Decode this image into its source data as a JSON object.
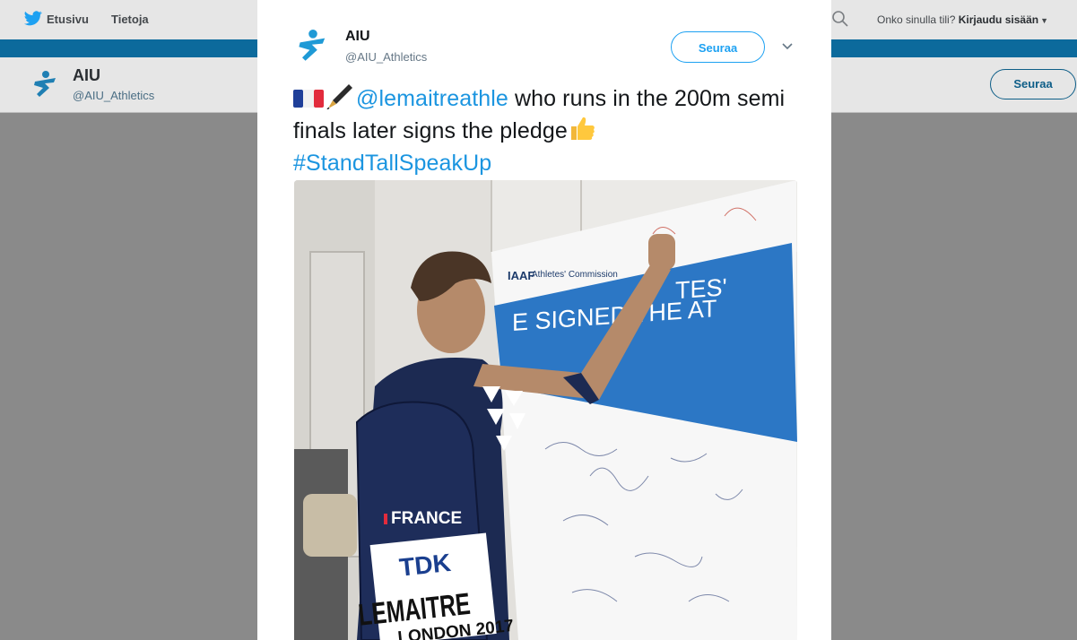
{
  "topnav": {
    "home_label": "Etusivu",
    "about_label": "Tietoja",
    "login_question": "Onko sinulla tili?",
    "login_link": "Kirjaudu sisään"
  },
  "profile_header": {
    "name": "AIU",
    "handle": "@AIU_Athletics",
    "follow_label": "Seuraa"
  },
  "tweet": {
    "author_name": "AIU",
    "author_handle": "@AIU_Athletics",
    "follow_label": "Seuraa",
    "mention": "@lemaitreathle",
    "text_part1": " who runs in the 200m semi finals later signs the pledge",
    "hashtag": "#StandTallSpeakUp"
  },
  "photo": {
    "board_heading": "E SIGNED THE AT",
    "board_heading_end": "TES'",
    "board_org": "Athletes' Commission",
    "board_brand": "IAAF",
    "bib_sponsor": "TDK",
    "bib_name": "LEMAITRE",
    "bib_event": "LONDON 2017",
    "bag_country": "FRANCE"
  },
  "colors": {
    "link": "#1b95e0",
    "brand_blue": "#1da1f2",
    "banner": "#0c6a9c",
    "aiu_logo": "#1f9ad6"
  },
  "icons": {
    "bird": "twitter-bird-icon",
    "search": "search-icon",
    "chevron": "chevron-down-icon",
    "logo": "aiu-logo-icon",
    "flag": "france-flag-emoji",
    "pen": "pen-emoji",
    "thumb": "thumbs-up-emoji"
  }
}
